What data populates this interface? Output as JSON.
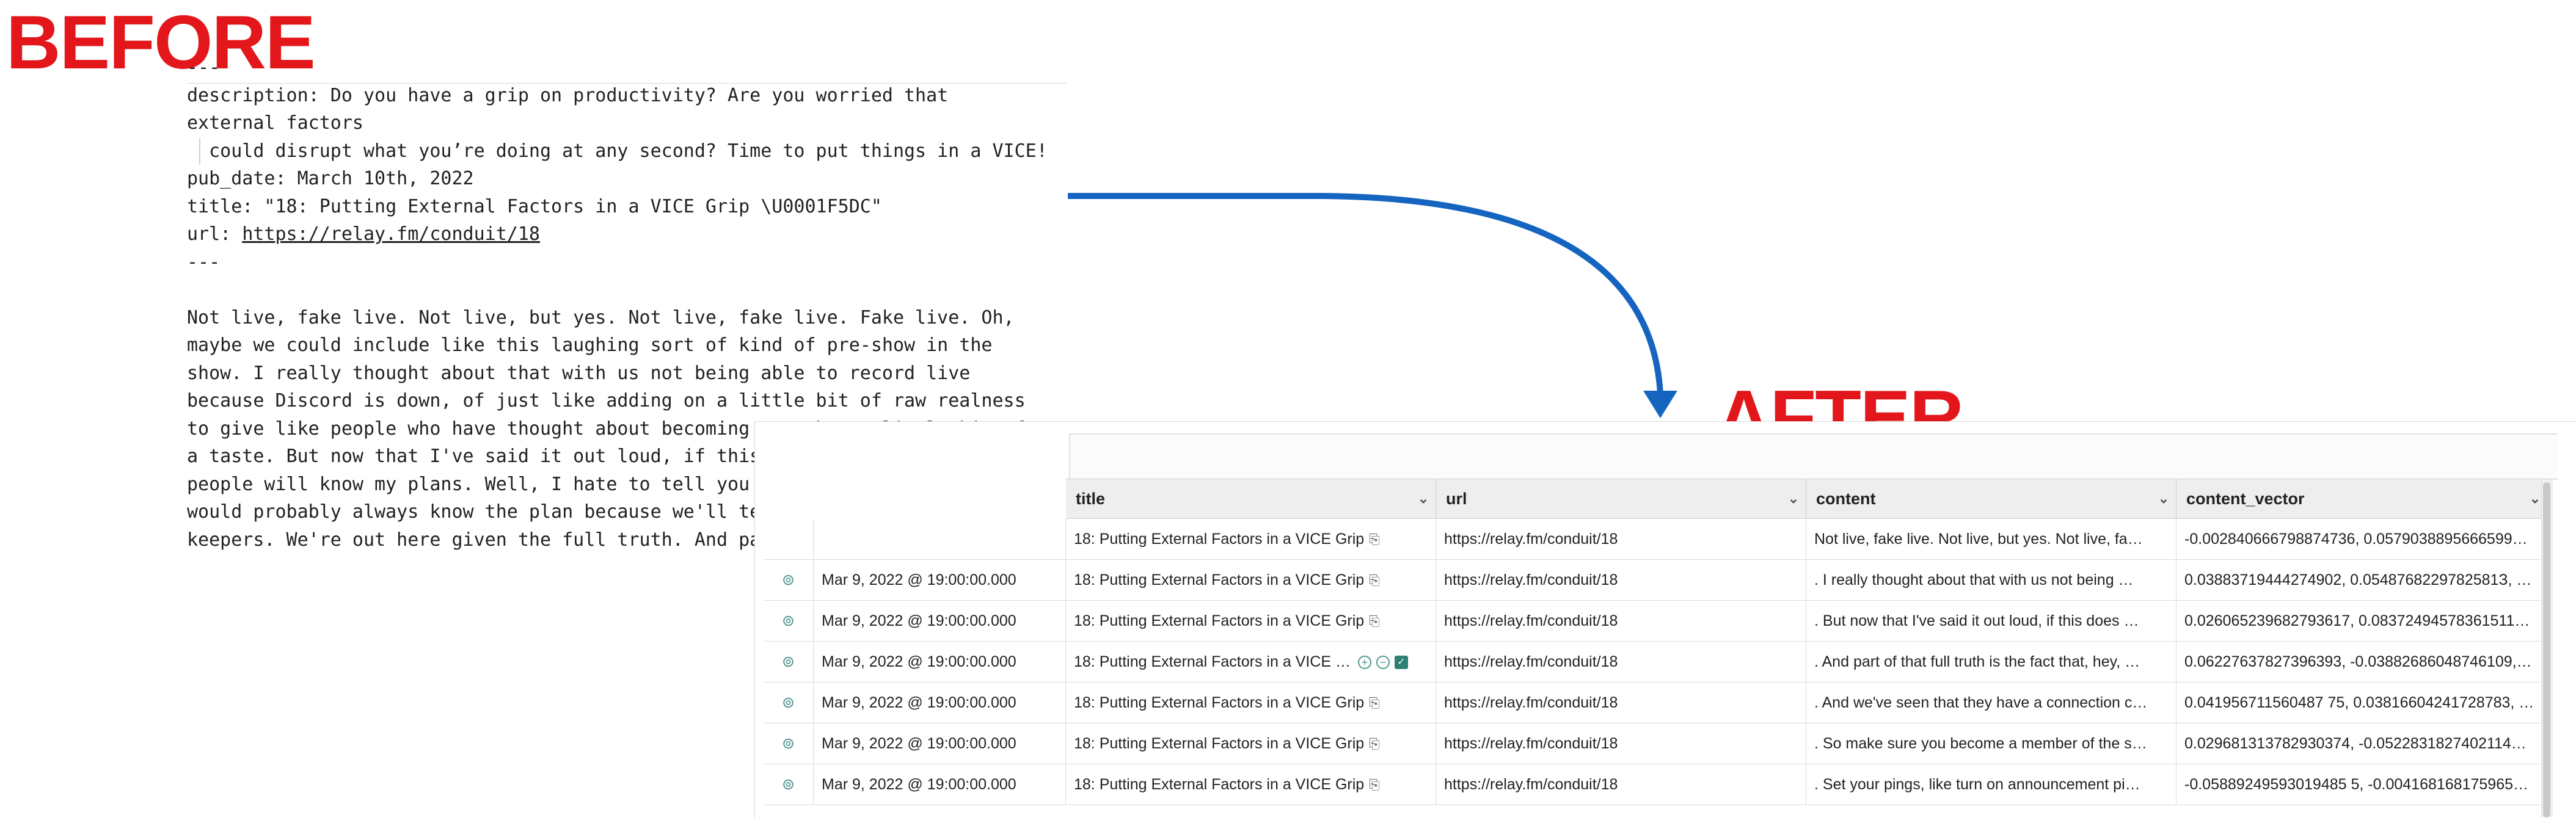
{
  "labels": {
    "before": "BEFORE",
    "after": "AFTER"
  },
  "document": {
    "lines": [
      "---",
      "description: Do you have a grip on productivity? Are you worried that",
      "external factors",
      "  could disrupt what you’re doing at any second? Time to put things in a VICE!",
      "pub_date: March 10th, 2022",
      "title: \"18: Putting External Factors in a VICE Grip \\U0001F5DC\"",
      "url: ",
      "---",
      "",
      "Not live, fake live. Not live, but yes. Not live, fake live. Fake live. Oh,",
      "maybe we could include like this laughing sort of kind of pre-show in the",
      "show. I really thought about that with us not being able to record live",
      "because Discord is down, of just like adding on a little bit of raw realness",
      "to give like people who have thought about becoming a member a little bit of",
      "a taste. But now that I've said it out loud, if this does stay in the show,",
      "people will know my plans. Well, I hate to tell you this, Jay, but people",
      "would probably always know the plan because we'll tell them. We're not secret",
      "keepers. We're out here given the full truth. And part of that full truth is"
    ],
    "url_link": "https://relay.fm/conduit/18"
  },
  "table": {
    "columns": [
      {
        "key": "title",
        "label": "title"
      },
      {
        "key": "url",
        "label": "url"
      },
      {
        "key": "content",
        "label": "content"
      },
      {
        "key": "content_vector",
        "label": "content_vector"
      }
    ],
    "rows": [
      {
        "date": "",
        "title": "18: Putting External Factors in a VICE Grip",
        "url": "https://relay.fm/conduit/18",
        "content": "Not live, fake live. Not live, but yes. Not live, fa…",
        "content_vector": "-0.002840666798874736, 0.0579038895666599…"
      },
      {
        "date": "Mar 9, 2022 @ 19:00:00.000",
        "title": "18: Putting External Factors in a VICE Grip",
        "url": "https://relay.fm/conduit/18",
        "content": ". I really thought about that with us not being …",
        "content_vector": "0.03883719444274902, 0.0548768229782581З, …"
      },
      {
        "date": "Mar 9, 2022 @ 19:00:00.000",
        "title": "18: Putting External Factors in a VICE Grip",
        "url": "https://relay.fm/conduit/18",
        "content": ". But now that I've said it out loud, if this does …",
        "content_vector": "0.026065239682793617, 0.08372494578361511…"
      },
      {
        "date": "Mar 9, 2022 @ 19:00:00.000",
        "title": "18: Putting External Factors in a VICE …",
        "url": "https://relay.fm/conduit/18",
        "content": ". And part of that full truth is the fact that, hey, …",
        "content_vector": "0.06227637827396393, -0.03882686048746109,…"
      },
      {
        "date": "Mar 9, 2022 @ 19:00:00.000",
        "title": "18: Putting External Factors in a VICE Grip",
        "url": "https://relay.fm/conduit/18",
        "content": ". And we've seen that they have a connection c…",
        "content_vector": "0.041956711560487 75, 0.03816604241728783, …"
      },
      {
        "date": "Mar 9, 2022 @ 19:00:00.000",
        "title": "18: Putting External Factors in a VICE Grip",
        "url": "https://relay.fm/conduit/18",
        "content": ". So make sure you become a member of the s…",
        "content_vector": "0.029681313782930374, -0.0522831827402114…"
      },
      {
        "date": "Mar 9, 2022 @ 19:00:00.000",
        "title": "18: Putting External Factors in a VICE Grip",
        "url": "https://relay.fm/conduit/18",
        "content": ". Set your pings, like turn on announcement pi…",
        "content_vector": "-0.05889249593019485 5, -0.004168168175965…"
      }
    ]
  },
  "colors": {
    "label_red": "#e3171b",
    "arrow_blue": "#1565c0",
    "accent_teal": "#4c8f8a"
  },
  "icons": {
    "row_icon": "inspect-icon",
    "copy": "copy-icon",
    "chevron": "chevron-down-icon"
  }
}
